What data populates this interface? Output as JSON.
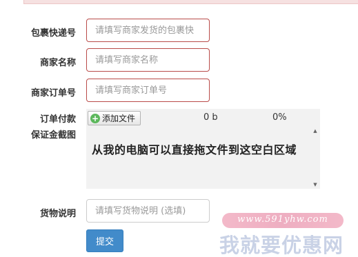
{
  "form": {
    "express_no": {
      "label": "包裹快递号",
      "placeholder": "请填写商家发货的包裹快"
    },
    "merchant_name": {
      "label": "商家名称",
      "placeholder": "请填写商家名称"
    },
    "merchant_order": {
      "label": "商家订单号",
      "placeholder": "请填写商家订单号"
    },
    "screenshot": {
      "label_line1": "订单付款",
      "label_line2": "保证金截图",
      "add_file_label": "添加文件",
      "file_size": "0 b",
      "progress": "0%",
      "drop_hint": "从我的电脑可以直接拖文件到这空白区域"
    },
    "goods_desc": {
      "label": "货物说明",
      "placeholder": "请填写货物说明 (选填)"
    },
    "submit_label": "提交"
  },
  "watermark": {
    "url": "www.591yhw.com",
    "brand": "我就要优惠网"
  },
  "colors": {
    "error_border": "#b94a48",
    "primary_button": "#428bca",
    "alert_background": "#f6e1e1"
  }
}
